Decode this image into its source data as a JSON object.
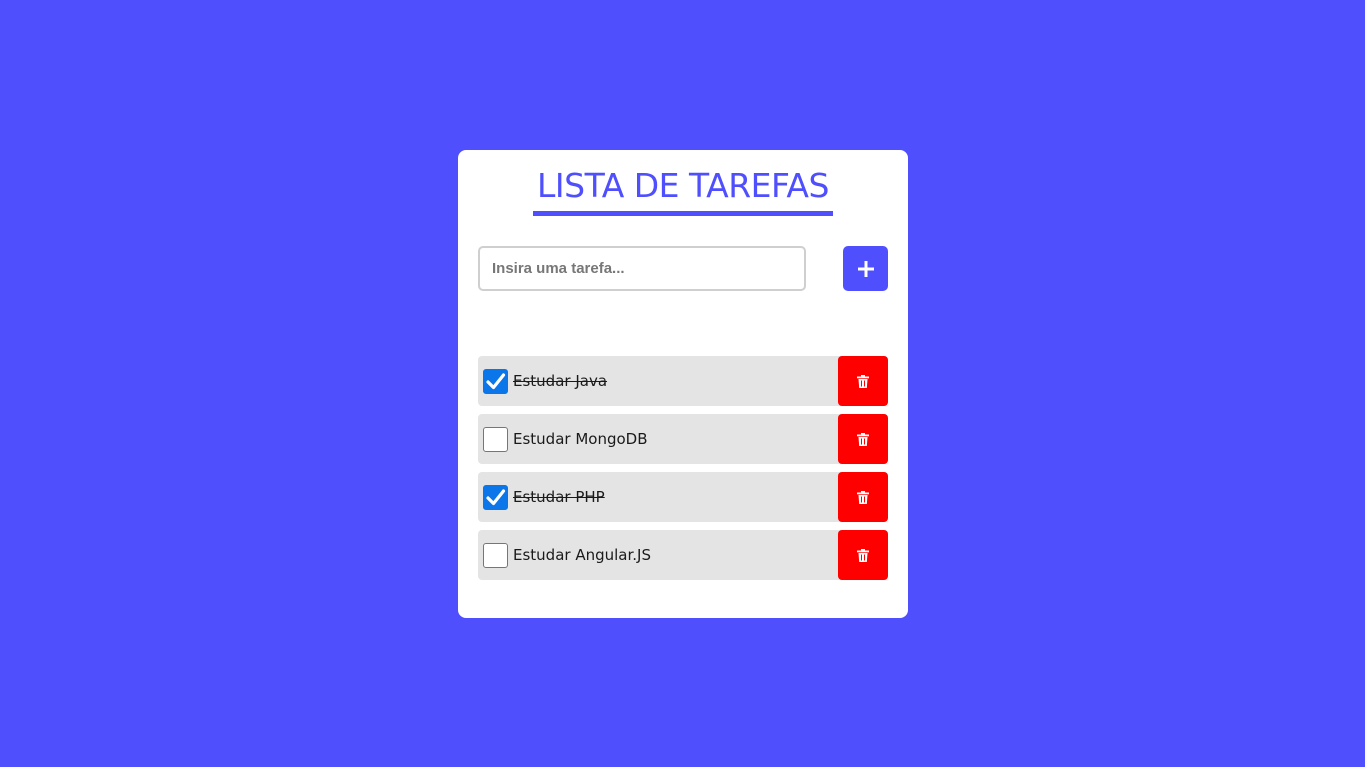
{
  "header": {
    "title": "LISTA DE TAREFAS"
  },
  "form": {
    "placeholder": "Insira uma tarefa...",
    "value": "",
    "add_icon": "plus-icon"
  },
  "tasks": [
    {
      "label": "Estudar Java",
      "done": true
    },
    {
      "label": "Estudar MongoDB",
      "done": false
    },
    {
      "label": "Estudar PHP",
      "done": true
    },
    {
      "label": "Estudar Angular.JS",
      "done": false
    }
  ],
  "icons": {
    "delete": "trash-icon",
    "check": "check-icon"
  },
  "colors": {
    "background": "#4f4ffe",
    "accent": "#4f4ffe",
    "delete": "#ff0000",
    "checked": "#0b75ea",
    "item_background": "#e4e4e4"
  }
}
